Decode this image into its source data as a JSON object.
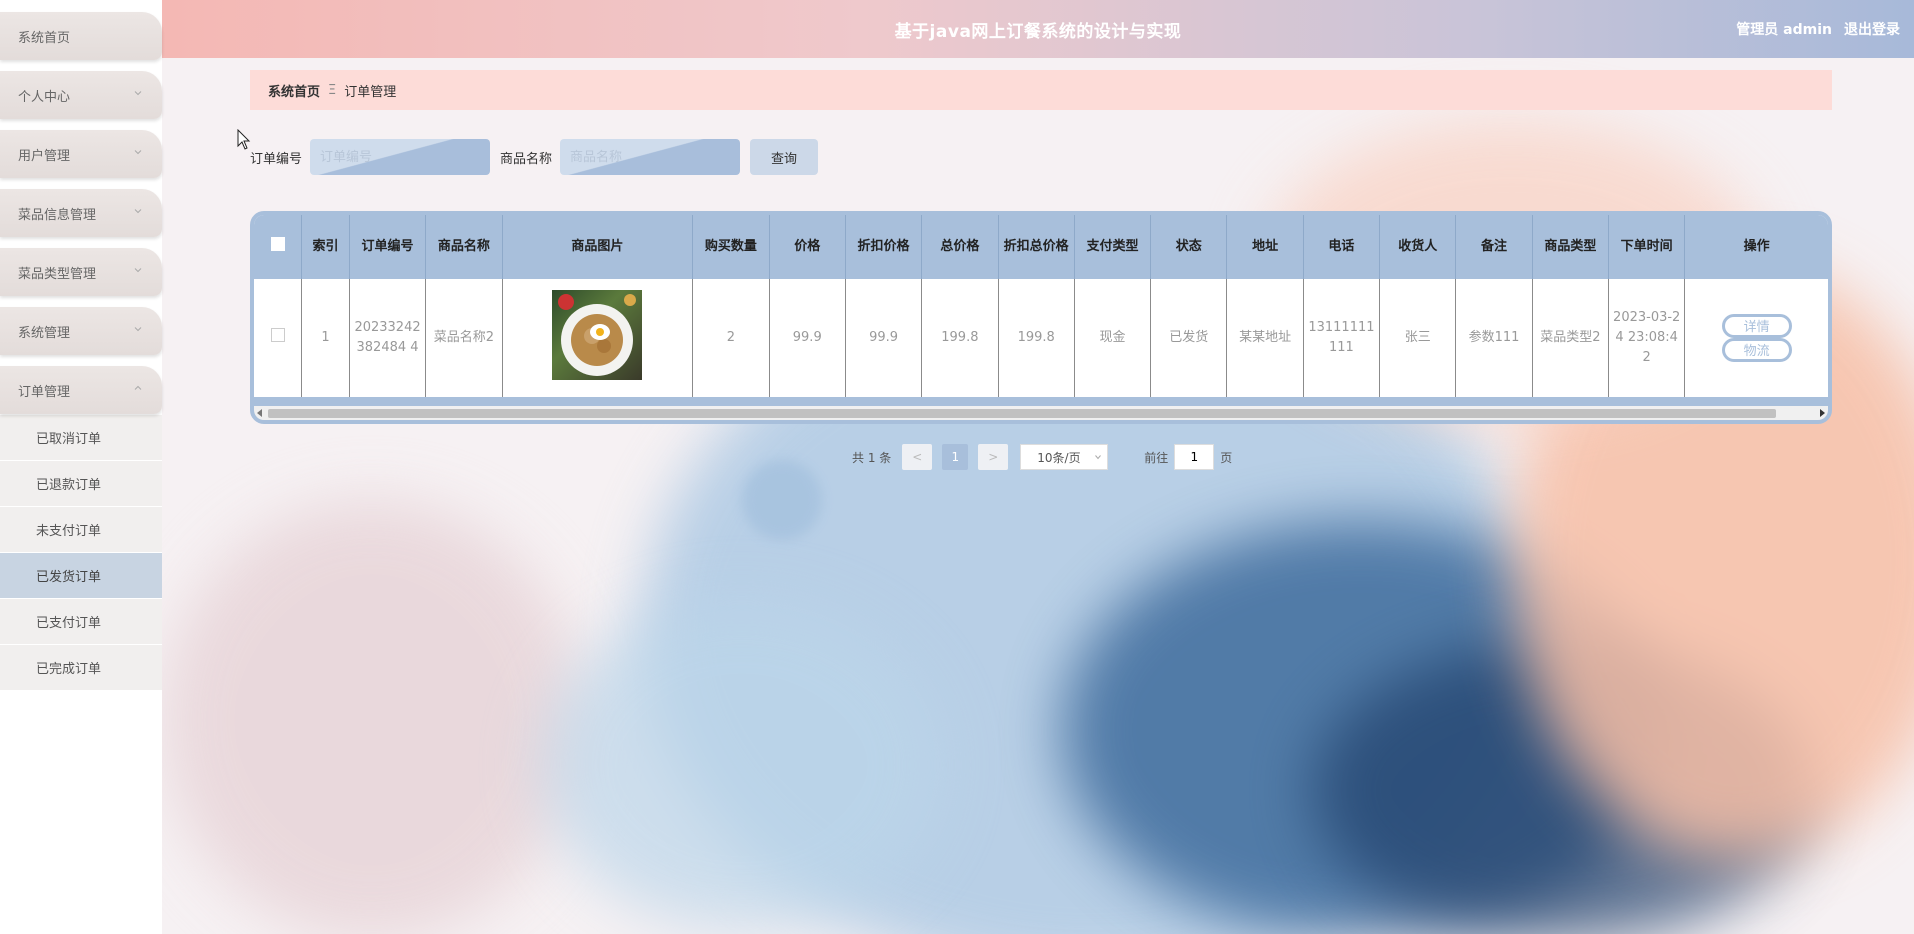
{
  "header": {
    "title": "基于java网上订餐系统的设计与实现",
    "user": "管理员 admin",
    "logout": "退出登录"
  },
  "sidebar": {
    "items": [
      {
        "label": "系统首页",
        "expandable": false
      },
      {
        "label": "个人中心",
        "expandable": true
      },
      {
        "label": "用户管理",
        "expandable": true
      },
      {
        "label": "菜品信息管理",
        "expandable": true
      },
      {
        "label": "菜品类型管理",
        "expandable": true
      },
      {
        "label": "系统管理",
        "expandable": true
      },
      {
        "label": "订单管理",
        "expandable": true,
        "expanded": true
      }
    ],
    "submenu": [
      {
        "label": "已取消订单",
        "active": false
      },
      {
        "label": "已退款订单",
        "active": false
      },
      {
        "label": "未支付订单",
        "active": false
      },
      {
        "label": "已发货订单",
        "active": true
      },
      {
        "label": "已支付订单",
        "active": false
      },
      {
        "label": "已完成订单",
        "active": false
      }
    ]
  },
  "breadcrumb": {
    "home": "系统首页",
    "separator": "Ξ",
    "current": "订单管理"
  },
  "search": {
    "order_no_label": "订单编号",
    "order_no_placeholder": "订单编号",
    "order_no_value": "",
    "goods_name_label": "商品名称",
    "goods_name_placeholder": "商品名称",
    "goods_name_value": "",
    "query_button": "查询"
  },
  "table": {
    "columns": [
      "索引",
      "订单编号",
      "商品名称",
      "商品图片",
      "购买数量",
      "价格",
      "折扣价格",
      "总价格",
      "折扣总价格",
      "支付类型",
      "状态",
      "地址",
      "电话",
      "收货人",
      "备注",
      "商品类型",
      "下单时间",
      "操作"
    ],
    "rows": [
      {
        "index": "1",
        "order_no": "20233242382484 4",
        "goods_name": "菜品名称2",
        "quantity": "2",
        "price": "99.9",
        "discount_price": "99.9",
        "total_price": "199.8",
        "discount_total": "199.8",
        "pay_type": "现金",
        "status": "已发货",
        "address": "某某地址",
        "phone": "13111111111",
        "receiver": "张三",
        "remark": "参数111",
        "goods_type": "菜品类型2",
        "order_time": "2023-03-24 23:08:42",
        "detail_button": "详情",
        "logistics_button": "物流"
      }
    ]
  },
  "pagination": {
    "total": "共 1 条",
    "prev": "<",
    "page": "1",
    "next": ">",
    "page_size": "10条/页",
    "goto_label": "前往",
    "goto_value": "1",
    "page_suffix": "页"
  },
  "colors": {
    "accent": "#a8bfdb",
    "header_start": "#f4b8b4",
    "breadcrumb_bg": "#fddcd8"
  }
}
